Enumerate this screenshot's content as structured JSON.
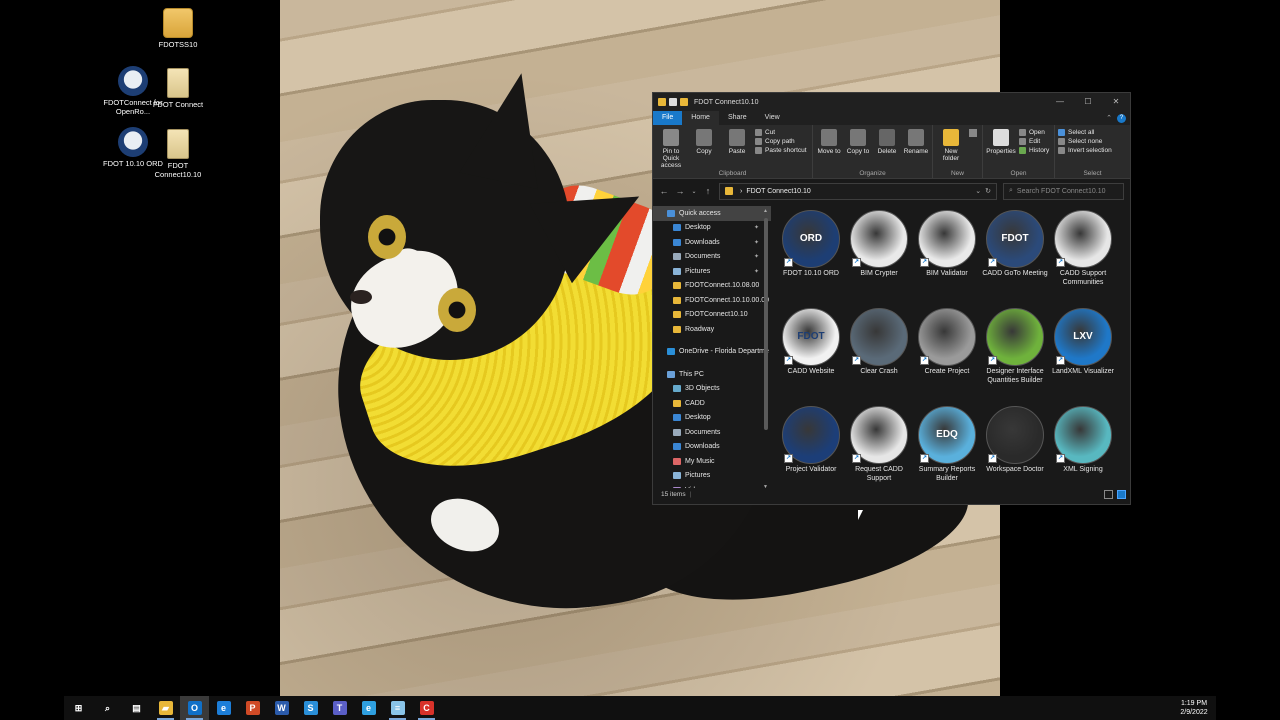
{
  "desktop": {
    "icons": [
      {
        "label": "FDOTSS10",
        "type": "folder"
      },
      {
        "label": "FDOTConnect for OpenRo...",
        "type": "ord"
      },
      {
        "label": "FDOT Connect",
        "type": "doc"
      },
      {
        "label": "FDOT 10.10 ORD",
        "type": "ord"
      },
      {
        "label": "FDOT Connect10.10",
        "type": "doc"
      }
    ]
  },
  "window": {
    "title": "FDOT Connect10.10",
    "controls": {
      "minimize": "—",
      "maximize": "☐",
      "close": "✕"
    },
    "tabs": [
      "File",
      "Home",
      "Share",
      "View"
    ],
    "active_tab": "Home",
    "ribbon": {
      "clipboard": {
        "name": "Clipboard",
        "pin": "Pin to Quick access",
        "copy": "Copy",
        "paste": "Paste",
        "cut": "Cut",
        "copy_path": "Copy path",
        "paste_shortcut": "Paste shortcut"
      },
      "organize": {
        "name": "Organize",
        "move_to": "Move to",
        "copy_to": "Copy to",
        "delete": "Delete",
        "rename": "Rename"
      },
      "new": {
        "name": "New",
        "new_folder": "New folder"
      },
      "open": {
        "name": "Open",
        "properties": "Properties",
        "open": "Open",
        "edit": "Edit",
        "history": "History"
      },
      "select": {
        "name": "Select",
        "select_all": "Select all",
        "select_none": "Select none",
        "invert_selection": "Invert selection"
      }
    },
    "address": {
      "path": "FDOT Connect10.10",
      "search_placeholder": "Search FDOT Connect10.10"
    },
    "nav": [
      {
        "label": "Quick access",
        "type": "quick",
        "selected": true
      },
      {
        "label": "Desktop",
        "type": "desktop",
        "pinned": true
      },
      {
        "label": "Downloads",
        "type": "downloads",
        "pinned": true
      },
      {
        "label": "Documents",
        "type": "documents",
        "pinned": true
      },
      {
        "label": "Pictures",
        "type": "pictures",
        "pinned": true
      },
      {
        "label": "FDOTConnect.10.08.00",
        "type": "folder"
      },
      {
        "label": "FDOTConnect.10.10.00.00",
        "type": "folder"
      },
      {
        "label": "FDOTConnect10.10",
        "type": "folder"
      },
      {
        "label": "Roadway",
        "type": "folder"
      },
      {
        "label": "OneDrive - Florida Departme",
        "type": "onedrive"
      },
      {
        "label": "This PC",
        "type": "pc"
      },
      {
        "label": "3D Objects",
        "type": "objects"
      },
      {
        "label": "CADD",
        "type": "folder"
      },
      {
        "label": "Desktop",
        "type": "desktop"
      },
      {
        "label": "Documents",
        "type": "documents"
      },
      {
        "label": "Downloads",
        "type": "downloads"
      },
      {
        "label": "My Music",
        "type": "music"
      },
      {
        "label": "Pictures",
        "type": "pictures"
      },
      {
        "label": "Videos",
        "type": "videos"
      }
    ],
    "items": [
      {
        "label": "FDOT 10.10 ORD",
        "badge": "ORD",
        "color": "#1d3e74"
      },
      {
        "label": "BIM Crypter",
        "badge": "",
        "color": "#e9e9e9"
      },
      {
        "label": "BIM Validator",
        "badge": "",
        "color": "#e9e9e9"
      },
      {
        "label": "CADD GoTo Meeting",
        "badge": "FDOT",
        "color": "#2b4a7a"
      },
      {
        "label": "CADD Support Communities",
        "badge": "",
        "color": "#e6e6e6"
      },
      {
        "label": "CADD Website",
        "badge": "FDOT",
        "color": "#f1f1f1"
      },
      {
        "label": "Clear Crash",
        "badge": "",
        "color": "#5a6a78"
      },
      {
        "label": "Create Project",
        "badge": "",
        "color": "#9a9a9a"
      },
      {
        "label": "Designer Interface Quantities Builder",
        "badge": "",
        "color": "#6fb23c"
      },
      {
        "label": "LandXML Visualizer",
        "badge": "LXV",
        "color": "#1f78c8"
      },
      {
        "label": "Project Validator",
        "badge": "",
        "color": "#1c3e78"
      },
      {
        "label": "Request CADD Support",
        "badge": "",
        "color": "#e6e6e6"
      },
      {
        "label": "Summary Reports Builder",
        "badge": "EDQ",
        "color": "#5ab0dc"
      },
      {
        "label": "Workspace Doctor",
        "badge": "",
        "color": "#2a2a2a"
      },
      {
        "label": "XML Signing",
        "badge": "",
        "color": "#58b8c0"
      }
    ],
    "status": {
      "item_count": "15 items"
    }
  },
  "taskbar": {
    "items": [
      {
        "name": "start",
        "glyph": "⊞",
        "color": "#101010"
      },
      {
        "name": "search",
        "glyph": "⌕",
        "color": "#101010"
      },
      {
        "name": "task-view",
        "glyph": "▤",
        "color": "#101010"
      },
      {
        "name": "file-explorer",
        "glyph": "▰",
        "color": "#e8b739"
      },
      {
        "name": "outlook",
        "glyph": "O",
        "color": "#1070c8"
      },
      {
        "name": "edge-legacy",
        "glyph": "e",
        "color": "#1d7ed8"
      },
      {
        "name": "powerpoint",
        "glyph": "P",
        "color": "#d04a26"
      },
      {
        "name": "word",
        "glyph": "W",
        "color": "#2b5bab"
      },
      {
        "name": "skype",
        "glyph": "S",
        "color": "#2a8fd8"
      },
      {
        "name": "teams",
        "glyph": "T",
        "color": "#5b5fc7"
      },
      {
        "name": "internet-explorer",
        "glyph": "e",
        "color": "#2fa0e0"
      },
      {
        "name": "notepad",
        "glyph": "≡",
        "color": "#8ac4e8"
      },
      {
        "name": "recorder",
        "glyph": "C",
        "color": "#d8322a"
      }
    ],
    "clock": {
      "time": "1:19 PM",
      "date": "2/9/2022"
    }
  },
  "colors": {
    "accent": "#1979ca",
    "window_bg": "#191919",
    "ribbon_bg": "#2b2b2b",
    "taskbar_bg": "#101010"
  }
}
